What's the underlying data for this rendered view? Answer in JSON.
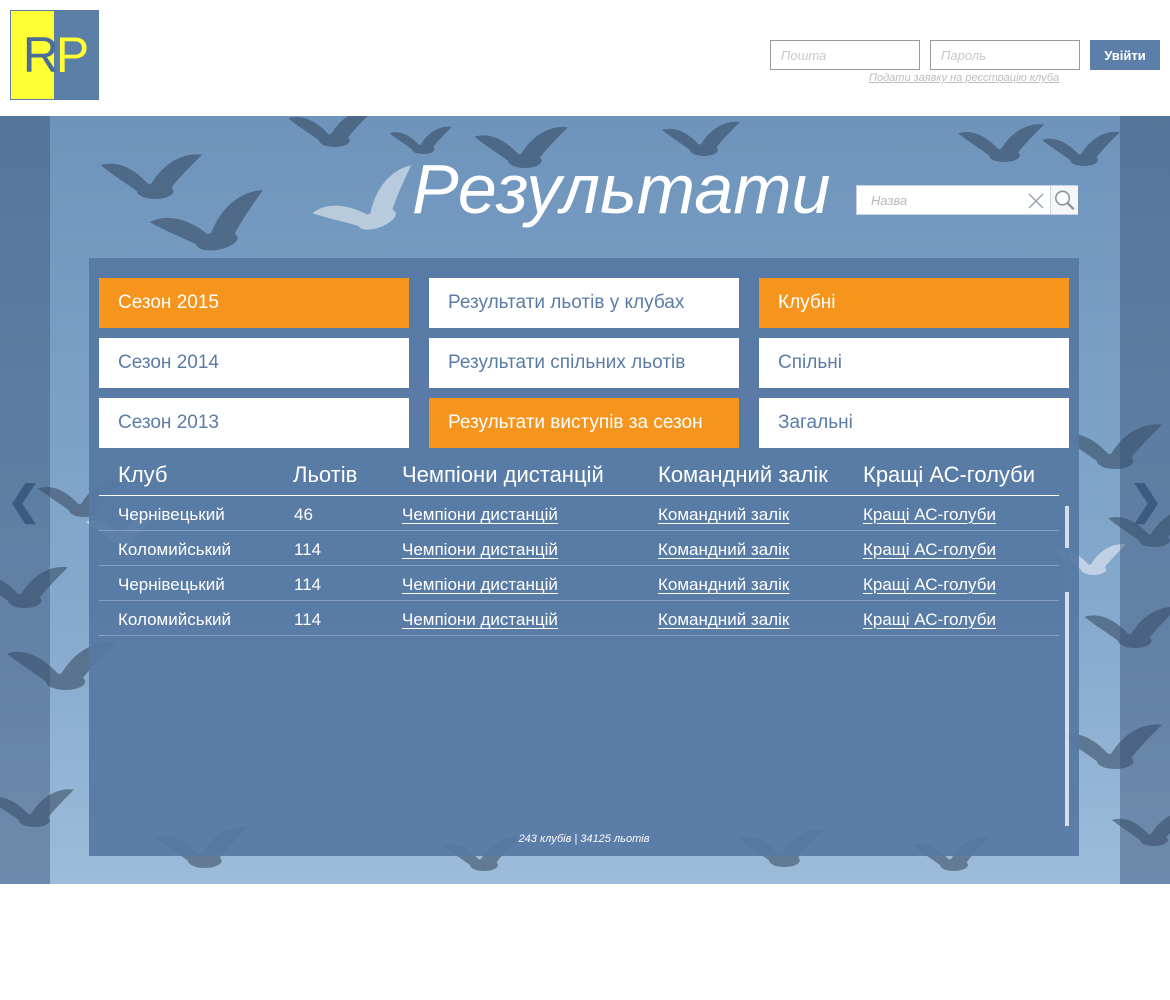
{
  "header": {
    "logo_text_left": "R",
    "logo_text_right": "P",
    "email_placeholder": "Пошта",
    "password_placeholder": "Пароль",
    "login_label": "Увійти",
    "register_link": "Подати заявку на реєстрацію клуба"
  },
  "page": {
    "title": "Результати",
    "search_placeholder": "Назва",
    "icons": {
      "clear": "close-icon",
      "search": "search-icon",
      "prev": "chevron-left-icon",
      "next": "chevron-right-icon"
    },
    "nav_prev": "❮",
    "nav_next": "❯"
  },
  "tiles": {
    "season_2015": "Сезон 2015",
    "season_2014": "Сезон 2014",
    "season_2013": "Сезон 2013",
    "club_flights": "Результати льотів у клубах",
    "joint_flights": "Результати спільних льотів",
    "season_performance": "Результати виступів за сезон",
    "club": "Клубні",
    "joint": "Спільні",
    "general": "Загальні"
  },
  "table": {
    "headers": [
      "Клуб",
      "Льотів",
      "Чемпіони дистанцій",
      "Командний залік",
      "Кращі АС-голуби"
    ],
    "rows": [
      [
        "Чернівецький",
        "46",
        "Чемпіони дистанцій",
        "Командний залік",
        "Кращі АС-голуби"
      ],
      [
        "Коломийський",
        "114",
        "Чемпіони дистанцій",
        "Командний залік",
        "Кращі АС-голуби"
      ],
      [
        "Чернівецький",
        "114",
        "Чемпіони дистанцій",
        "Командний залік",
        "Кращі АС-голуби"
      ],
      [
        "Коломийський",
        "114",
        "Чемпіони дистанцій",
        "Командний залік",
        "Кращі АС-голуби"
      ]
    ],
    "summary": "243 клубів | 34125 льотів"
  },
  "colors": {
    "accent_orange": "#f5951e",
    "brand_blue": "#5b7fa8",
    "logo_yellow": "#ffff33",
    "panel_blue": "#5678a4"
  }
}
